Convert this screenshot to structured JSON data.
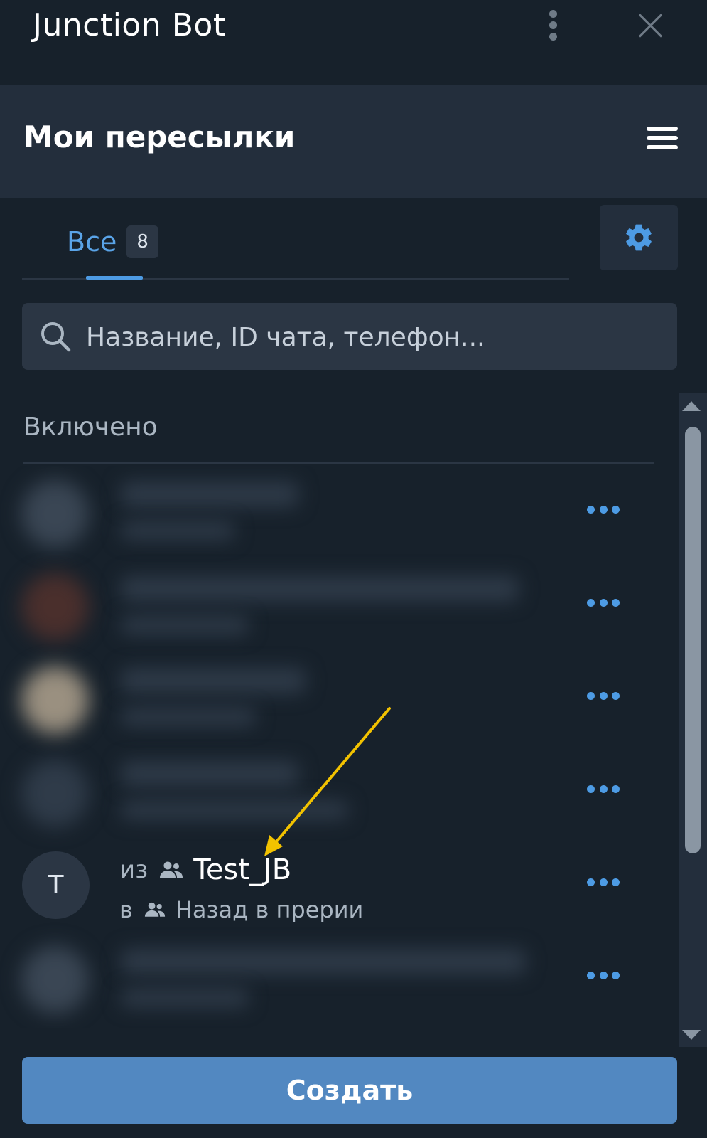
{
  "titlebar": {
    "title": "Junction Bot",
    "menu_icon": "kebab-icon",
    "close_icon": "close-icon"
  },
  "header": {
    "title": "Мои пересылки",
    "menu_icon": "hamburger-icon"
  },
  "tabs": [
    {
      "label": "Все",
      "count": "8",
      "active": true
    }
  ],
  "settings_icon": "gear-icon",
  "search": {
    "placeholder": "Название, ID чата, телефон..."
  },
  "section": {
    "title": "Включено"
  },
  "forwards": [
    {
      "blurred": true,
      "more_icon": "more-dots-icon"
    },
    {
      "blurred": true,
      "more_icon": "more-dots-icon"
    },
    {
      "blurred": true,
      "more_icon": "more-dots-icon"
    },
    {
      "blurred": true,
      "more_icon": "more-dots-icon"
    },
    {
      "blurred": false,
      "avatar_letter": "T",
      "from_prefix": "из",
      "from_name": "Test_JB",
      "to_prefix": "в",
      "to_name": "Назад в прерии",
      "more_icon": "more-dots-icon"
    },
    {
      "blurred": true,
      "more_icon": "more-dots-icon"
    }
  ],
  "create_button": {
    "label": "Создать"
  },
  "colors": {
    "background": "#17212b",
    "panel": "#232e3c",
    "accent": "#5288c1",
    "link": "#4d9be4",
    "annotation_arrow": "#f2c200"
  }
}
